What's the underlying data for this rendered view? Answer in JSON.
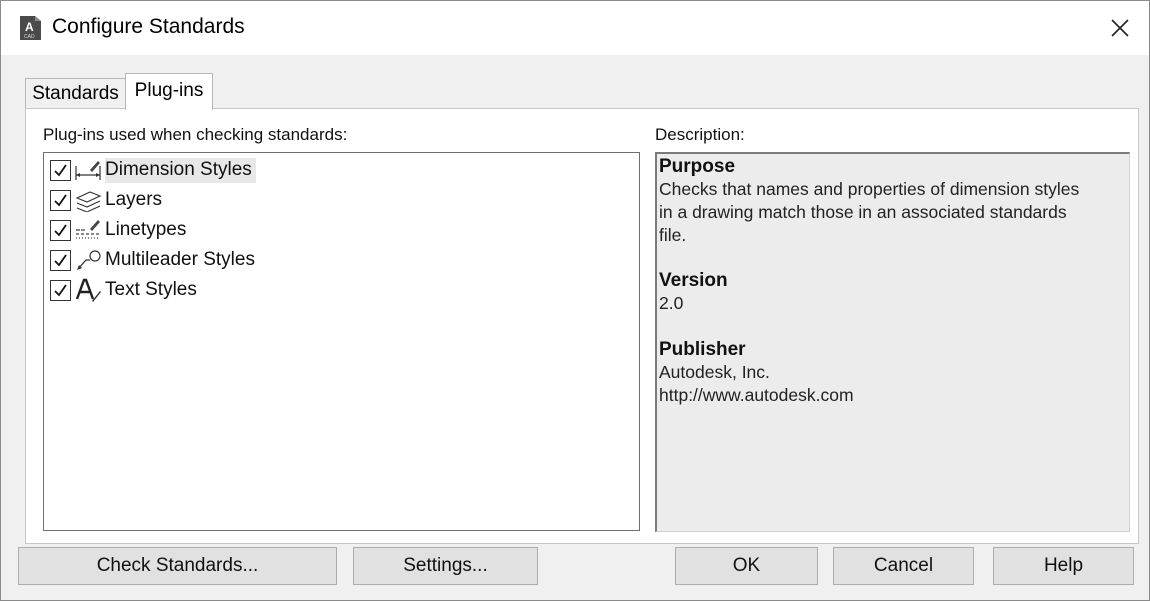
{
  "window": {
    "title": "Configure Standards",
    "app_icon_letter": "A",
    "app_icon_sub": "CAD"
  },
  "tabs": [
    {
      "label": "Standards",
      "active": false
    },
    {
      "label": "Plug-ins",
      "active": true
    }
  ],
  "plugins": {
    "label": "Plug-ins used when checking standards:",
    "items": [
      {
        "label": "Dimension Styles",
        "checked": true,
        "icon": "dimension-styles-icon",
        "selected": true
      },
      {
        "label": "Layers",
        "checked": true,
        "icon": "layers-icon",
        "selected": false
      },
      {
        "label": "Linetypes",
        "checked": true,
        "icon": "linetypes-icon",
        "selected": false
      },
      {
        "label": "Multileader Styles",
        "checked": true,
        "icon": "multileader-styles-icon",
        "selected": false
      },
      {
        "label": "Text Styles",
        "checked": true,
        "icon": "text-styles-icon",
        "selected": false
      }
    ]
  },
  "description": {
    "label": "Description:",
    "purpose_heading": "Purpose",
    "purpose_line1": "Checks that names and properties of dimension styles",
    "purpose_line2": "in a drawing match those in an associated standards",
    "purpose_line3": "file.",
    "version_heading": "Version",
    "version_value": "2.0",
    "publisher_heading": "Publisher",
    "publisher_name": "Autodesk, Inc.",
    "publisher_url": "http://www.autodesk.com"
  },
  "buttons": {
    "check_standards": "Check Standards...",
    "settings": "Settings...",
    "ok": "OK",
    "cancel": "Cancel",
    "help": "Help"
  }
}
